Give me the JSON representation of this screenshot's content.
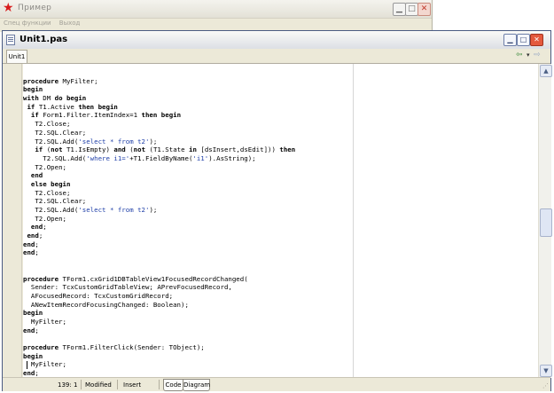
{
  "background_window": {
    "title": "Пример",
    "menu": [
      "Спец функции",
      "Выход"
    ]
  },
  "editor_window": {
    "title": "Unit1.pas",
    "tab": "Unit1",
    "nav": {
      "back": "⇦",
      "dropdown": "▾",
      "forward": "⇨"
    }
  },
  "code_lines": [
    "",
    "procedure MyFilter;",
    "begin",
    "with DM do begin",
    " if T1.Active then begin",
    "  if Form1.Filter.ItemIndex=1 then begin",
    "   T2.Close;",
    "   T2.SQL.Clear;",
    "   T2.SQL.Add('select * from t2');",
    "   if (not T1.IsEmpty) and (not (T1.State in [dsInsert,dsEdit])) then",
    "     T2.SQL.Add('where i1='+T1.FieldByName('i1').AsString);",
    "   T2.Open;",
    "  end",
    "  else begin",
    "   T2.Close;",
    "   T2.SQL.Clear;",
    "   T2.SQL.Add('select * from t2');",
    "   T2.Open;",
    "  end;",
    " end;",
    "end;",
    "end;",
    "",
    "",
    "procedure TForm1.cxGrid1DBTableView1FocusedRecordChanged(",
    "  Sender: TcxCustomGridTableView; APrevFocusedRecord,",
    "  AFocusedRecord: TcxCustomGridRecord;",
    "  ANewItemRecordFocusingChanged: Boolean);",
    "begin",
    "  MyFilter;",
    "end;",
    "",
    "procedure TForm1.FilterClick(Sender: TObject);",
    "begin",
    "  MyFilter;",
    "end;"
  ],
  "status_bar": {
    "position": "139:  1",
    "modified": "Modified",
    "mode": "Insert",
    "tab_code": "Code",
    "tab_diagram": "Diagram"
  },
  "icons": [
    "app-star-icon",
    "document-icon",
    "minimize-icon",
    "maximize-icon",
    "close-icon"
  ]
}
